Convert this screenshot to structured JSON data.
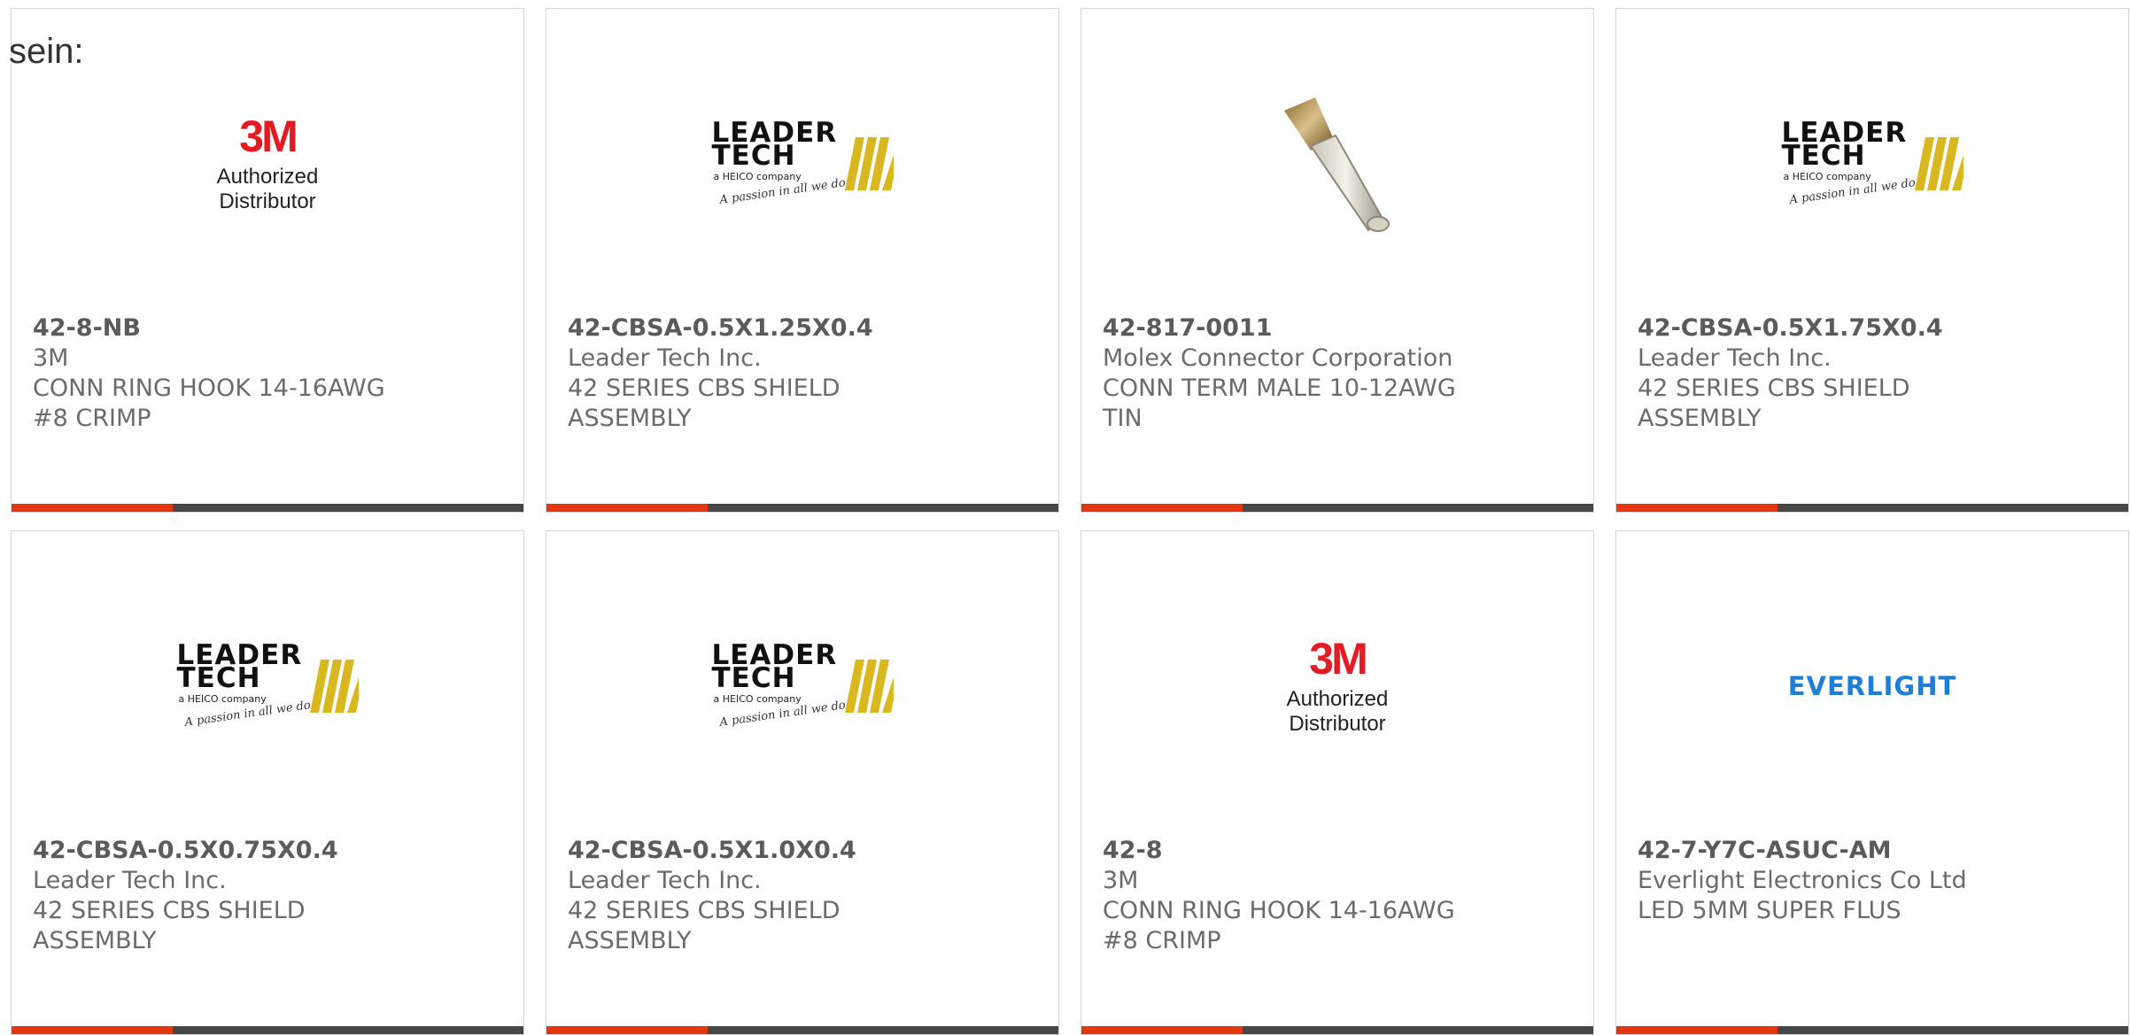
{
  "intro_text": "sein:",
  "colors": {
    "accent": "#e5370f",
    "bar": "#474747",
    "brand_3m": "#e31b23",
    "everlight": "#1f7fd6",
    "leader_stripes": "#d9b71f"
  },
  "products": [
    {
      "part_number": "42-8-NB",
      "manufacturer": "3M",
      "description": "CONN RING HOOK 14-16AWG #8 CRIMP",
      "image": "3m-logo",
      "logo_text": "3M",
      "logo_sub": "Authorized Distributor"
    },
    {
      "part_number": "42-CBSA-0.5X1.25X0.4",
      "manufacturer": "Leader Tech Inc.",
      "description": "42 SERIES CBS SHIELD ASSEMBLY",
      "image": "leader-tech-logo",
      "logo_text": "LEADER",
      "logo_text2": "TECH",
      "logo_sub": "a HEICO company",
      "logo_tagline": "A passion in all we do"
    },
    {
      "part_number": "42-817-0011",
      "manufacturer": "Molex Connector Corporation",
      "description": "CONN TERM MALE 10-12AWG TIN",
      "image": "crimp-terminal-photo"
    },
    {
      "part_number": "42-CBSA-0.5X1.75X0.4",
      "manufacturer": "Leader Tech Inc.",
      "description": "42 SERIES CBS SHIELD ASSEMBLY",
      "image": "leader-tech-logo",
      "logo_text": "LEADER",
      "logo_text2": "TECH",
      "logo_sub": "a HEICO company",
      "logo_tagline": "A passion in all we do"
    },
    {
      "part_number": "42-CBSA-0.5X0.75X0.4",
      "manufacturer": "Leader Tech Inc.",
      "description": "42 SERIES CBS SHIELD ASSEMBLY",
      "image": "leader-tech-logo",
      "logo_text": "LEADER",
      "logo_text2": "TECH",
      "logo_sub": "a HEICO company",
      "logo_tagline": "A passion in all we do"
    },
    {
      "part_number": "42-CBSA-0.5X1.0X0.4",
      "manufacturer": "Leader Tech Inc.",
      "description": "42 SERIES CBS SHIELD ASSEMBLY",
      "image": "leader-tech-logo",
      "logo_text": "LEADER",
      "logo_text2": "TECH",
      "logo_sub": "a HEICO company",
      "logo_tagline": "A passion in all we do"
    },
    {
      "part_number": "42-8",
      "manufacturer": "3M",
      "description": "CONN RING HOOK 14-16AWG #8 CRIMP",
      "image": "3m-logo",
      "logo_text": "3M",
      "logo_sub": "Authorized Distributor"
    },
    {
      "part_number": "42-7-Y7C-ASUC-AM",
      "manufacturer": "Everlight Electronics Co Ltd",
      "description": "LED 5MM SUPER FLUS",
      "image": "everlight-logo",
      "logo_text": "EVERLIGHT"
    }
  ]
}
